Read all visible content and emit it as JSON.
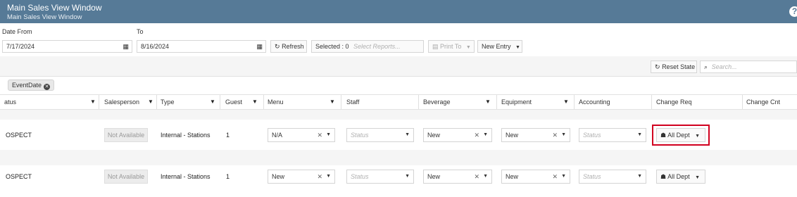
{
  "window": {
    "title": "Main Sales View Window",
    "subtitle": "Main Sales View Window",
    "help_label": "?"
  },
  "filters": {
    "date_from_label": "Date From",
    "date_from_value": "7/17/2024",
    "to_label": "To",
    "to_value": "8/16/2024",
    "refresh_label": "Refresh",
    "selected_label": "Selected : 0",
    "select_reports_placeholder": "Select Reports...",
    "print_to_label": "Print To",
    "new_entry_label": "New Entry"
  },
  "toolbar2": {
    "reset_state_label": "Reset State",
    "search_placeholder": "Search..."
  },
  "group_chip": {
    "label": "EventDate"
  },
  "columns": [
    "atus",
    "Salesperson",
    "Type",
    "Guest",
    "Menu",
    "Staff",
    "Beverage",
    "Equipment",
    "Accounting",
    "Change Req",
    "Change Cnt"
  ],
  "rows": [
    {
      "status": "OSPECT",
      "salesperson": "Not Available",
      "type": "Internal - Stations",
      "guest": "1",
      "menu": "N/A",
      "staff": "Status",
      "beverage": "New",
      "equipment": "New",
      "accounting": "Status",
      "change_req": "All Dept",
      "change_cnt": ""
    },
    {
      "status": "OSPECT",
      "salesperson": "Not Available",
      "type": "Internal - Stations",
      "guest": "1",
      "menu": "New",
      "staff": "Status",
      "beverage": "New",
      "equipment": "New",
      "accounting": "Status",
      "change_req": "All Dept",
      "change_cnt": ""
    }
  ],
  "colors": {
    "titlebar": "#567a97",
    "highlight": "#d1001f"
  },
  "icons": [
    "calendar-icon",
    "refresh-icon",
    "printer-icon",
    "search-icon",
    "close-icon",
    "chevron-down-icon",
    "filter-icon",
    "group-icon"
  ]
}
